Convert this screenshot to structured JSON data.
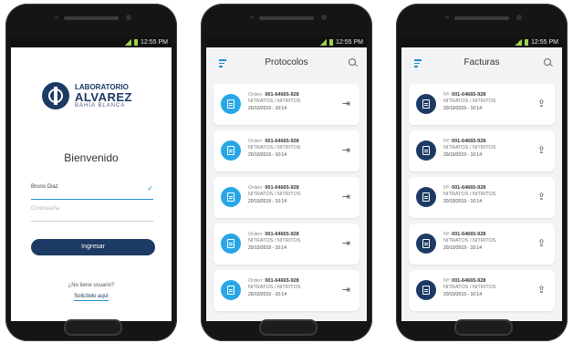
{
  "status_time": "12:55 PM",
  "login": {
    "logo_line1": "LABORATORIO",
    "logo_line2": "ALVAREZ",
    "logo_line3": "BAHÍA BLANCA",
    "welcome": "Bienvenido",
    "user_value": "Bruno Diaz",
    "password_placeholder": "Contraseña",
    "login_button": "Ingresar",
    "no_account": "¿No tiene usuario?",
    "signup_link": "Solicítelo aquí"
  },
  "protocols": {
    "title": "Protocolos",
    "items": [
      {
        "label": "Orden:",
        "number": "001-64665-928",
        "sub": "NITRATOS / NITRITOS",
        "date": "20/10/2019 - 10:14"
      },
      {
        "label": "Orden:",
        "number": "001-64665-928",
        "sub": "NITRATOS / NITRITOS",
        "date": "20/10/2019 - 10:14"
      },
      {
        "label": "Orden:",
        "number": "001-64665-928",
        "sub": "NITRATOS / NITRITOS",
        "date": "20/10/2019 - 10:14"
      },
      {
        "label": "Orden:",
        "number": "001-64665-928",
        "sub": "NITRATOS / NITRITOS",
        "date": "20/10/2019 - 10:14"
      },
      {
        "label": "Orden:",
        "number": "001-64665-928",
        "sub": "NITRATOS / NITRITOS",
        "date": "20/10/2019 - 10:14"
      }
    ]
  },
  "invoices": {
    "title": "Facturas",
    "items": [
      {
        "label": "Nº:",
        "number": "001-64665-928",
        "sub": "NITRATOS / NITRITOS",
        "date": "20/10/2019 - 10:14"
      },
      {
        "label": "Nº:",
        "number": "001-64665-928",
        "sub": "NITRATOS / NITRITOS",
        "date": "20/10/2019 - 10:14"
      },
      {
        "label": "Nº:",
        "number": "001-64665-928",
        "sub": "NITRATOS / NITRITOS",
        "date": "20/10/2019 - 10:14"
      },
      {
        "label": "Nº:",
        "number": "001-64665-928",
        "sub": "NITRATOS / NITRITOS",
        "date": "20/10/2019 - 10:14"
      },
      {
        "label": "Nº:",
        "number": "001-64665-928",
        "sub": "NITRATOS / NITRITOS",
        "date": "20/10/2019 - 10:14"
      }
    ]
  },
  "colors": {
    "navy": "#1c3a63",
    "accent_blue": "#29a6e6",
    "link_blue": "#1c8fd1"
  }
}
